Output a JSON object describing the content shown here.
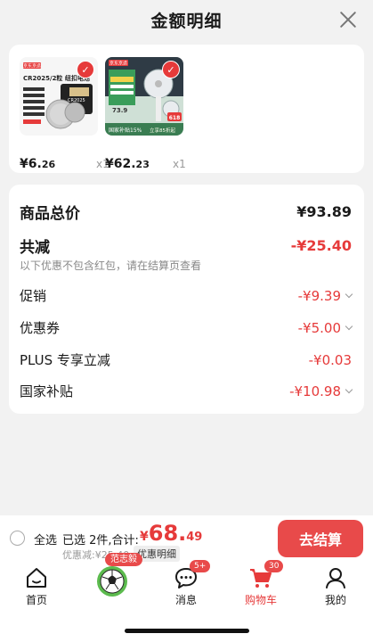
{
  "header": {
    "title": "金额明细"
  },
  "products": [
    {
      "image_text": {
        "title": "CR2025/2粒 纽扣电池",
        "model": "CR2025",
        "brand": "京东京造"
      },
      "price_int": "¥6.",
      "price_dec": "26",
      "qty": "x1"
    },
    {
      "image_text": {
        "brand": "京东京造",
        "badge_price": "73.9",
        "badge_618": "618",
        "subsidy": "国家补贴15%",
        "promo": "立享85折起"
      },
      "price_int": "¥62.",
      "price_dec": "23",
      "qty": "x1"
    }
  ],
  "summary": {
    "goods_total_label": "商品总价",
    "goods_total_value": "¥93.89",
    "reduce_label": "共减",
    "reduce_value": "-¥25.40",
    "note": "以下优惠不包含红包，请在结算页查看",
    "items": [
      {
        "label": "促销",
        "value": "-¥9.39"
      },
      {
        "label": "优惠券",
        "value": "-¥5.00"
      },
      {
        "label": "PLUS 专享立减",
        "value": "-¥0.03"
      },
      {
        "label": "国家补贴",
        "value": "-¥10.98"
      }
    ]
  },
  "bottom_bar": {
    "select_all": "全选",
    "selected": "已选 2件,合计:",
    "total_symbol": "¥",
    "total_int": "68.",
    "total_dec": "49",
    "discount": "优惠减:¥25.40",
    "detail_tag": "优惠明细",
    "checkout": "去结算"
  },
  "tabbar": {
    "home": "首页",
    "activity_badge": "范志毅",
    "messages": "消息",
    "messages_badge": "5+",
    "cart": "购物车",
    "cart_badge": "30",
    "mine": "我的"
  },
  "colors": {
    "accent": "#e63a3a",
    "button": "#e84a4a"
  }
}
